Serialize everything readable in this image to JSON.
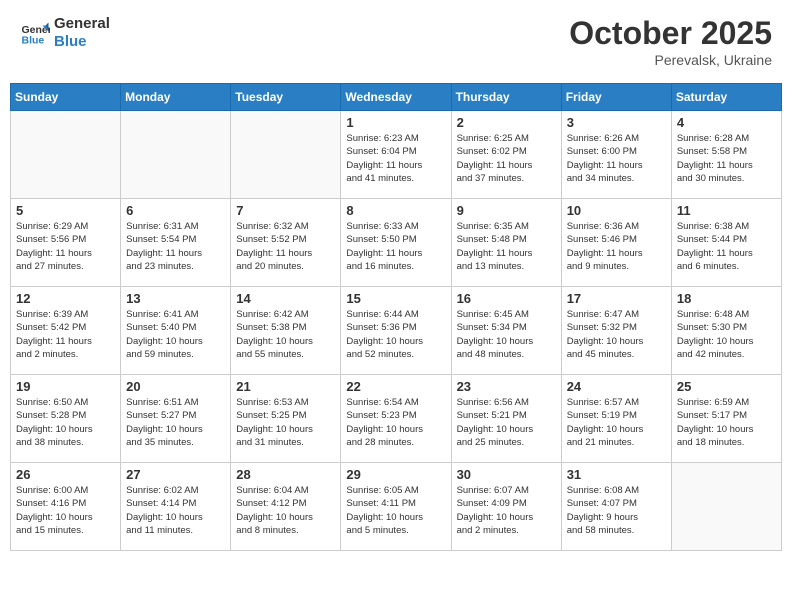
{
  "header": {
    "logo_line1": "General",
    "logo_line2": "Blue",
    "month": "October 2025",
    "location": "Perevalsk, Ukraine"
  },
  "weekdays": [
    "Sunday",
    "Monday",
    "Tuesday",
    "Wednesday",
    "Thursday",
    "Friday",
    "Saturday"
  ],
  "weeks": [
    [
      {
        "day": "",
        "info": ""
      },
      {
        "day": "",
        "info": ""
      },
      {
        "day": "",
        "info": ""
      },
      {
        "day": "1",
        "info": "Sunrise: 6:23 AM\nSunset: 6:04 PM\nDaylight: 11 hours\nand 41 minutes."
      },
      {
        "day": "2",
        "info": "Sunrise: 6:25 AM\nSunset: 6:02 PM\nDaylight: 11 hours\nand 37 minutes."
      },
      {
        "day": "3",
        "info": "Sunrise: 6:26 AM\nSunset: 6:00 PM\nDaylight: 11 hours\nand 34 minutes."
      },
      {
        "day": "4",
        "info": "Sunrise: 6:28 AM\nSunset: 5:58 PM\nDaylight: 11 hours\nand 30 minutes."
      }
    ],
    [
      {
        "day": "5",
        "info": "Sunrise: 6:29 AM\nSunset: 5:56 PM\nDaylight: 11 hours\nand 27 minutes."
      },
      {
        "day": "6",
        "info": "Sunrise: 6:31 AM\nSunset: 5:54 PM\nDaylight: 11 hours\nand 23 minutes."
      },
      {
        "day": "7",
        "info": "Sunrise: 6:32 AM\nSunset: 5:52 PM\nDaylight: 11 hours\nand 20 minutes."
      },
      {
        "day": "8",
        "info": "Sunrise: 6:33 AM\nSunset: 5:50 PM\nDaylight: 11 hours\nand 16 minutes."
      },
      {
        "day": "9",
        "info": "Sunrise: 6:35 AM\nSunset: 5:48 PM\nDaylight: 11 hours\nand 13 minutes."
      },
      {
        "day": "10",
        "info": "Sunrise: 6:36 AM\nSunset: 5:46 PM\nDaylight: 11 hours\nand 9 minutes."
      },
      {
        "day": "11",
        "info": "Sunrise: 6:38 AM\nSunset: 5:44 PM\nDaylight: 11 hours\nand 6 minutes."
      }
    ],
    [
      {
        "day": "12",
        "info": "Sunrise: 6:39 AM\nSunset: 5:42 PM\nDaylight: 11 hours\nand 2 minutes."
      },
      {
        "day": "13",
        "info": "Sunrise: 6:41 AM\nSunset: 5:40 PM\nDaylight: 10 hours\nand 59 minutes."
      },
      {
        "day": "14",
        "info": "Sunrise: 6:42 AM\nSunset: 5:38 PM\nDaylight: 10 hours\nand 55 minutes."
      },
      {
        "day": "15",
        "info": "Sunrise: 6:44 AM\nSunset: 5:36 PM\nDaylight: 10 hours\nand 52 minutes."
      },
      {
        "day": "16",
        "info": "Sunrise: 6:45 AM\nSunset: 5:34 PM\nDaylight: 10 hours\nand 48 minutes."
      },
      {
        "day": "17",
        "info": "Sunrise: 6:47 AM\nSunset: 5:32 PM\nDaylight: 10 hours\nand 45 minutes."
      },
      {
        "day": "18",
        "info": "Sunrise: 6:48 AM\nSunset: 5:30 PM\nDaylight: 10 hours\nand 42 minutes."
      }
    ],
    [
      {
        "day": "19",
        "info": "Sunrise: 6:50 AM\nSunset: 5:28 PM\nDaylight: 10 hours\nand 38 minutes."
      },
      {
        "day": "20",
        "info": "Sunrise: 6:51 AM\nSunset: 5:27 PM\nDaylight: 10 hours\nand 35 minutes."
      },
      {
        "day": "21",
        "info": "Sunrise: 6:53 AM\nSunset: 5:25 PM\nDaylight: 10 hours\nand 31 minutes."
      },
      {
        "day": "22",
        "info": "Sunrise: 6:54 AM\nSunset: 5:23 PM\nDaylight: 10 hours\nand 28 minutes."
      },
      {
        "day": "23",
        "info": "Sunrise: 6:56 AM\nSunset: 5:21 PM\nDaylight: 10 hours\nand 25 minutes."
      },
      {
        "day": "24",
        "info": "Sunrise: 6:57 AM\nSunset: 5:19 PM\nDaylight: 10 hours\nand 21 minutes."
      },
      {
        "day": "25",
        "info": "Sunrise: 6:59 AM\nSunset: 5:17 PM\nDaylight: 10 hours\nand 18 minutes."
      }
    ],
    [
      {
        "day": "26",
        "info": "Sunrise: 6:00 AM\nSunset: 4:16 PM\nDaylight: 10 hours\nand 15 minutes."
      },
      {
        "day": "27",
        "info": "Sunrise: 6:02 AM\nSunset: 4:14 PM\nDaylight: 10 hours\nand 11 minutes."
      },
      {
        "day": "28",
        "info": "Sunrise: 6:04 AM\nSunset: 4:12 PM\nDaylight: 10 hours\nand 8 minutes."
      },
      {
        "day": "29",
        "info": "Sunrise: 6:05 AM\nSunset: 4:11 PM\nDaylight: 10 hours\nand 5 minutes."
      },
      {
        "day": "30",
        "info": "Sunrise: 6:07 AM\nSunset: 4:09 PM\nDaylight: 10 hours\nand 2 minutes."
      },
      {
        "day": "31",
        "info": "Sunrise: 6:08 AM\nSunset: 4:07 PM\nDaylight: 9 hours\nand 58 minutes."
      },
      {
        "day": "",
        "info": ""
      }
    ]
  ]
}
